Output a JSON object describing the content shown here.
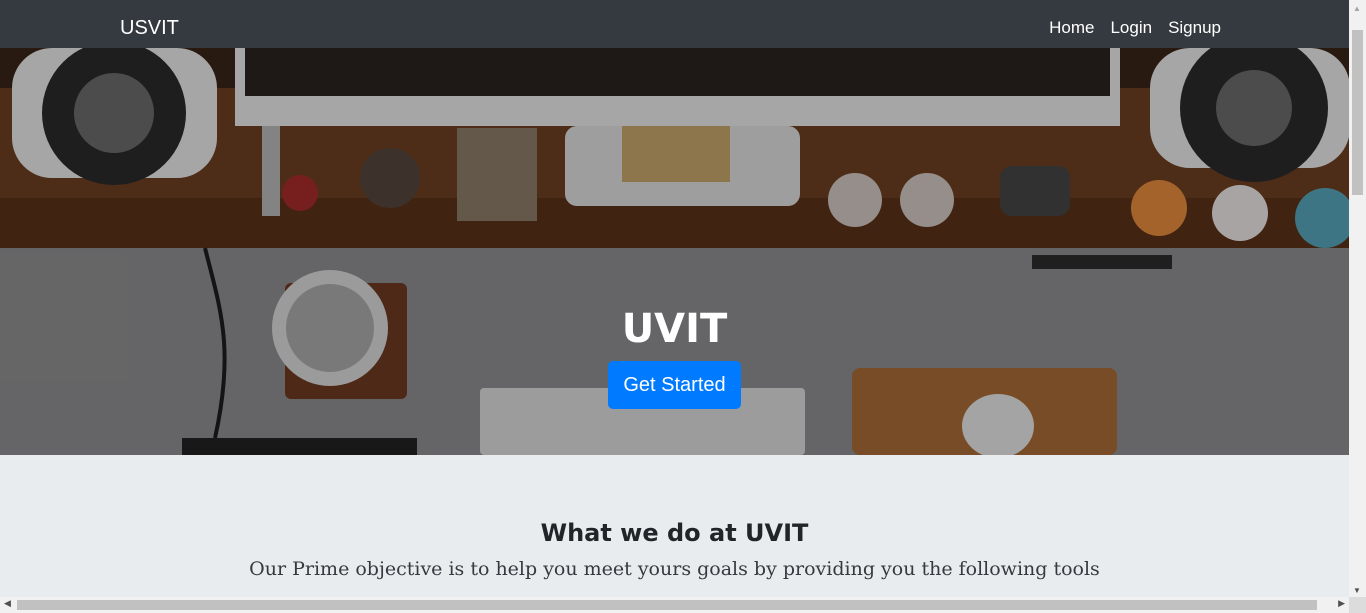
{
  "navbar": {
    "brand": "USVIT",
    "links": [
      "Home",
      "Login",
      "Signup"
    ]
  },
  "hero": {
    "title": "UVIT",
    "cta_label": "Get Started"
  },
  "section": {
    "title": "What we do at UVIT",
    "subtitle": "Our Prime objective is to help you meet yours goals by providing you the following tools"
  },
  "colors": {
    "navbar_bg": "#343a40",
    "cta_bg": "#007bff",
    "page_bg": "#e9ecef"
  },
  "icons": {
    "scroll_up": "▲",
    "scroll_down": "▼",
    "scroll_left": "◀",
    "scroll_right": "▶"
  }
}
